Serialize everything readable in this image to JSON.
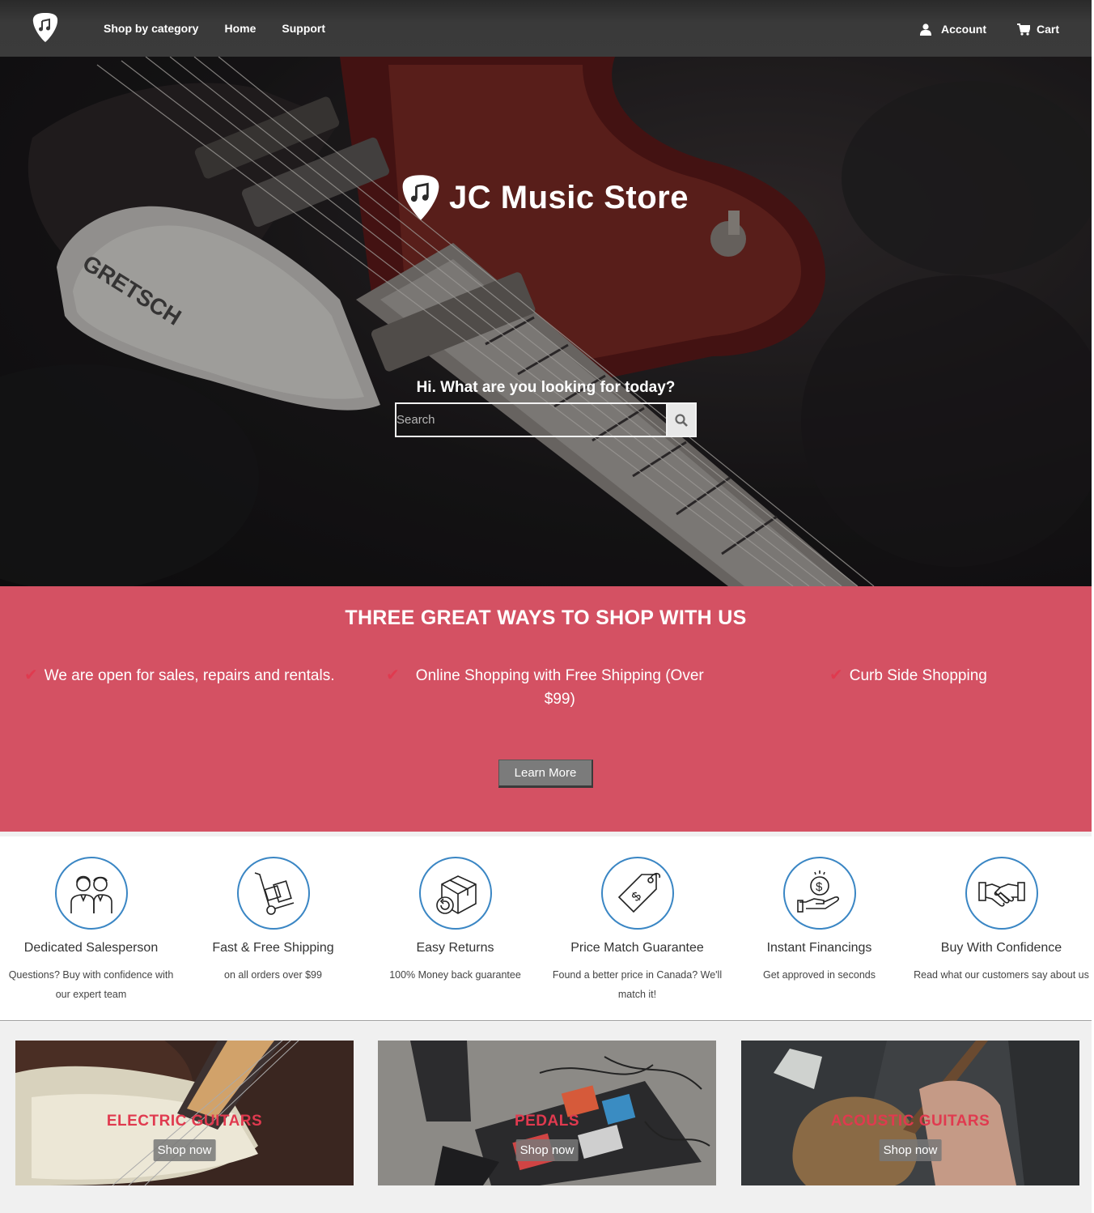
{
  "nav": {
    "logo_icon": "guitar-pick-music-note-icon",
    "links": [
      "Shop by category",
      "Home",
      "Support"
    ],
    "account_label": "Account",
    "cart_label": "Cart"
  },
  "hero": {
    "brand": "JC Music Store",
    "prompt": "Hi. What are you looking for today?",
    "search_placeholder": "Search"
  },
  "band": {
    "title": "THREE GREAT WAYS TO SHOP WITH US",
    "ways": [
      "We are open for sales, repairs and rentals.",
      "Online Shopping with Free Shipping (Over $99)",
      "Curb Side Shopping"
    ],
    "learn_more": "Learn More",
    "color": "#d45163"
  },
  "features": [
    {
      "icon": "salespeople-icon",
      "title": "Dedicated Salesperson",
      "desc": "Questions? Buy with confidence with our expert team"
    },
    {
      "icon": "hand-truck-icon",
      "title": "Fast & Free Shipping",
      "desc": "on all orders over $99"
    },
    {
      "icon": "box-return-icon",
      "title": "Easy Returns",
      "desc": "100% Money back guarantee"
    },
    {
      "icon": "price-tag-icon",
      "title": "Price Match Guarantee",
      "desc": "Found a better price in Canada? We'll match it!"
    },
    {
      "icon": "coin-hand-icon",
      "title": "Instant Financings",
      "desc": "Get approved in seconds"
    },
    {
      "icon": "handshake-icon",
      "title": "Buy With Confidence",
      "desc": "Read what our customers say about us"
    }
  ],
  "categories": [
    {
      "name": "ELECTRIC GUITARS",
      "cta": "Shop now"
    },
    {
      "name": "PEDALS",
      "cta": "Shop now"
    },
    {
      "name": "ACOUSTIC GUITARS",
      "cta": "Shop now"
    }
  ]
}
